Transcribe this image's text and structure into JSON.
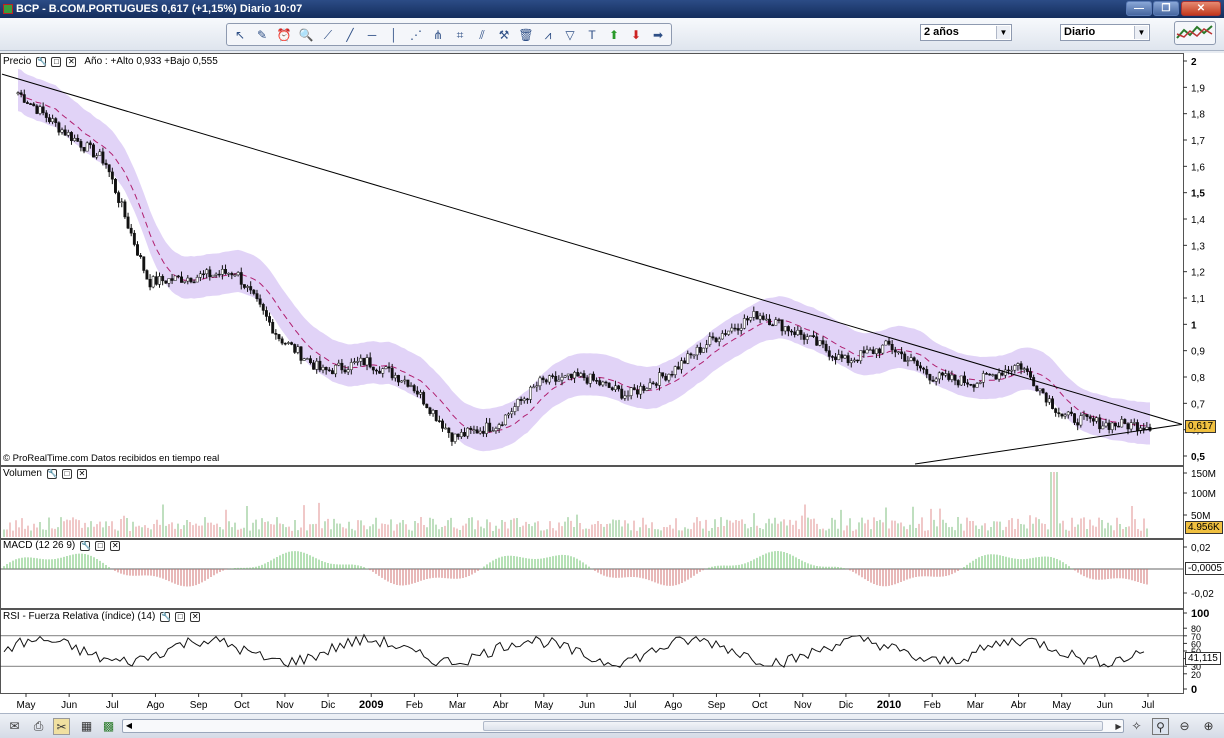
{
  "window": {
    "title": "BCP - B.COM.PORTUGUES    0,617 (+1,15%)   Diario  10:07",
    "buttons": [
      "minimize",
      "restore",
      "close"
    ]
  },
  "toolbar": {
    "tools": [
      "pointer-icon",
      "ruler-icon",
      "alarm-icon",
      "zoom-icon",
      "segment-icon",
      "trendline-icon",
      "horizontal-line-icon",
      "vertical-line-icon",
      "fibonacci-fan-icon",
      "andrews-fork-icon",
      "gann-icon",
      "parallel-channel-icon",
      "tools-icon",
      "trash-icon",
      "chart-pattern-icon",
      "fibonacci-icon",
      "text-icon",
      "buy-arrow-icon",
      "sell-arrow-icon",
      "right-arrow-icon"
    ],
    "period_select": "2 años",
    "interval_select": "Diario"
  },
  "panels": {
    "price": {
      "label": "Precio",
      "info": "Año : +Alto 0,933 +Bajo 0,555",
      "footer": "© ProRealTime.com  Datos recibidos en tiempo real",
      "current_price": "0,617",
      "y_ticks": [
        "2",
        "1,9",
        "1,8",
        "1,7",
        "1,6",
        "1,5",
        "1,4",
        "1,3",
        "1,2",
        "1,1",
        "1",
        "0,9",
        "0,8",
        "0,7",
        "0,6",
        "0,5"
      ]
    },
    "volume": {
      "label": "Volumen",
      "y_ticks": [
        "150M",
        "100M",
        "50M"
      ],
      "current": "4.956K"
    },
    "macd": {
      "label": "MACD (12 26 9)",
      "y_ticks": [
        "0,02",
        "-0,02"
      ],
      "current": "-0,0005"
    },
    "rsi": {
      "label": "RSI - Fuerza Relativa (índice) (14)",
      "y_ticks": [
        "100",
        "80",
        "70",
        "60",
        "50",
        "40",
        "30",
        "20",
        "0"
      ],
      "current": "41,115"
    }
  },
  "x_axis": [
    "May",
    "Jun",
    "Jul",
    "Ago",
    "Sep",
    "Oct",
    "Nov",
    "Dic",
    "2009",
    "Feb",
    "Mar",
    "Abr",
    "May",
    "Jun",
    "Jul",
    "Ago",
    "Sep",
    "Oct",
    "Nov",
    "Dic",
    "2010",
    "Feb",
    "Mar",
    "Abr",
    "May",
    "Jun",
    "Jul"
  ],
  "chart_data": {
    "type": "line",
    "title": "BCP - B.COM.PORTUGUES",
    "x": [
      "May",
      "Jun",
      "Jul",
      "Ago",
      "Sep",
      "Oct",
      "Nov",
      "Dic",
      "2009",
      "Feb",
      "Mar",
      "Abr",
      "May",
      "Jun",
      "Jul",
      "Ago",
      "Sep",
      "Oct",
      "Nov",
      "Dic",
      "2010",
      "Feb",
      "Mar",
      "Abr",
      "May",
      "Jun",
      "Jul"
    ],
    "series": [
      {
        "values": [
          1.88,
          1.74,
          1.62,
          1.16,
          1.18,
          1.2,
          0.95,
          0.82,
          0.86,
          0.78,
          0.57,
          0.62,
          0.78,
          0.8,
          0.73,
          0.82,
          0.95,
          1.04,
          0.96,
          0.86,
          0.92,
          0.8,
          0.78,
          0.85,
          0.65,
          0.62,
          0.617
        ]
      }
    ],
    "ylim": [
      0.5,
      2.0
    ],
    "grid": false
  },
  "statusbar": {
    "icons": [
      "mail-icon",
      "print-icon",
      "scissors-icon",
      "calculator-icon",
      "layout-icon",
      "scroll-left-icon",
      "scroll-right-icon",
      "scroll-end-icon",
      "magic-icon",
      "zoom-fit-icon",
      "zoom-out-icon",
      "zoom-in-icon"
    ]
  }
}
